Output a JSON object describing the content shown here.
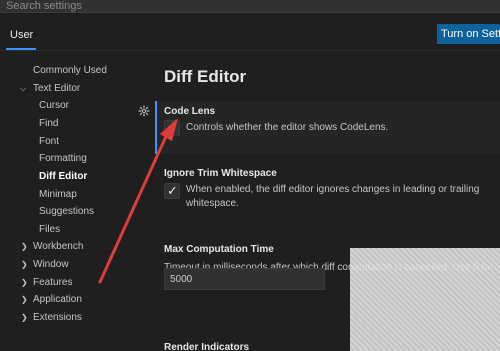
{
  "search": {
    "placeholder": "Search settings"
  },
  "tabs": {
    "user": "User"
  },
  "sync_button": "Turn on Settings Sync",
  "toc": {
    "items": [
      {
        "label": "Commonly Used",
        "chevron": ""
      },
      {
        "label": "Text Editor",
        "chevron": "v"
      },
      {
        "label": "Cursor",
        "chevron": ""
      },
      {
        "label": "Find",
        "chevron": ""
      },
      {
        "label": "Font",
        "chevron": ""
      },
      {
        "label": "Formatting",
        "chevron": ""
      },
      {
        "label": "Diff Editor",
        "chevron": ""
      },
      {
        "label": "Minimap",
        "chevron": ""
      },
      {
        "label": "Suggestions",
        "chevron": ""
      },
      {
        "label": "Files",
        "chevron": ""
      },
      {
        "label": "Workbench",
        "chevron": ">"
      },
      {
        "label": "Window",
        "chevron": ">"
      },
      {
        "label": "Features",
        "chevron": ">"
      },
      {
        "label": "Application",
        "chevron": ">"
      },
      {
        "label": "Extensions",
        "chevron": ">"
      }
    ]
  },
  "main": {
    "section_title": "Diff Editor",
    "settings": [
      {
        "title": "Code Lens",
        "description": "Controls whether the editor shows CodeLens.",
        "checked": false
      },
      {
        "title": "Ignore Trim Whitespace",
        "description": "When enabled, the diff editor ignores changes in leading or trailing whitespace.",
        "checked": true
      },
      {
        "title": "Max Computation Time",
        "description": "Timeout in milliseconds after which diff computation is cancelled. Use 0 for no timeout.",
        "value": "5000"
      },
      {
        "title": "Render Indicators"
      }
    ]
  },
  "colors": {
    "accent": "#3794ff",
    "button": "#0e639c",
    "arrow": "#e03c3c"
  }
}
